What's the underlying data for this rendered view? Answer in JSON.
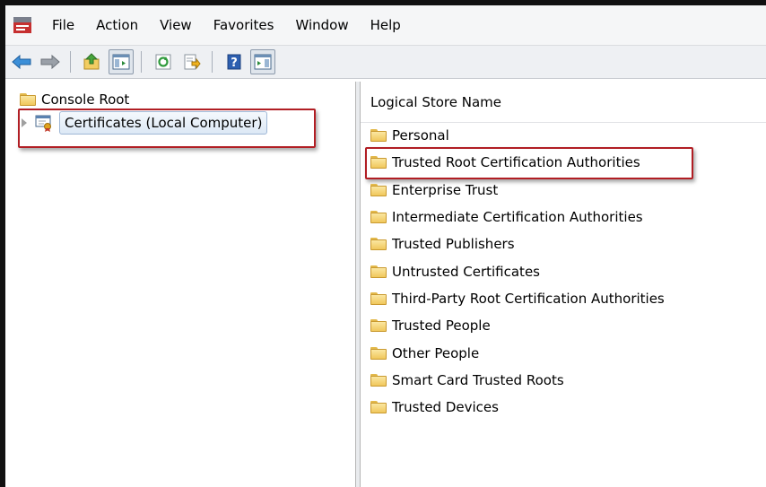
{
  "menu": {
    "items": [
      "File",
      "Action",
      "View",
      "Favorites",
      "Window",
      "Help"
    ]
  },
  "toolbar": {
    "buttons": [
      "back-arrow-icon",
      "forward-arrow-icon",
      "up-folder-icon",
      "show-hide-console-tree-icon",
      "refresh-icon",
      "export-list-icon",
      "help-icon",
      "show-hide-action-pane-icon"
    ]
  },
  "tree": {
    "root_label": "Console Root",
    "child_label": "Certificates (Local Computer)"
  },
  "list": {
    "column_header": "Logical Store Name",
    "items": [
      "Personal",
      "Trusted Root Certification Authorities",
      "Enterprise Trust",
      "Intermediate Certification Authorities",
      "Trusted Publishers",
      "Untrusted Certificates",
      "Third-Party Root Certification Authorities",
      "Trusted People",
      "Other People",
      "Smart Card Trusted Roots",
      "Trusted Devices"
    ]
  },
  "colors": {
    "highlight": "#b11e24",
    "folder": "#f0c75b"
  }
}
